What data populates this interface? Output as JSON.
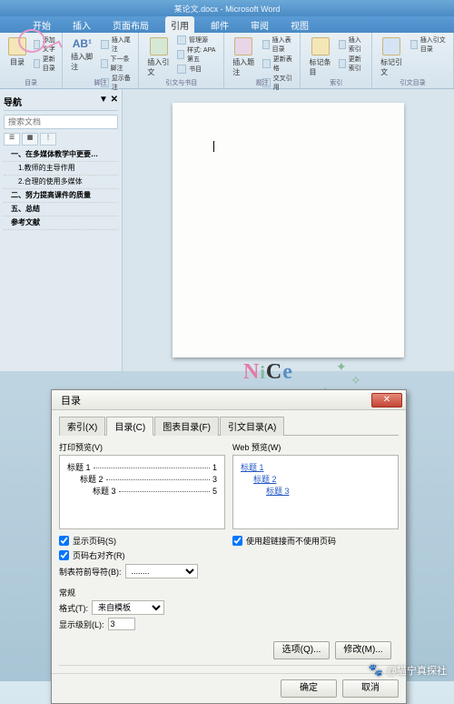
{
  "titlebar": "某论文.docx - Microsoft Word",
  "ribbon_tabs": [
    "开始",
    "插入",
    "页面布局",
    "引用",
    "邮件",
    "审阅",
    "视图"
  ],
  "ribbon_active_tab": "引用",
  "ribbon": {
    "g1": {
      "big": "目录",
      "rows": [
        "添加文字",
        "更新目录"
      ],
      "label": "目录"
    },
    "g2": {
      "big": "插入脚注",
      "ab": "AB¹",
      "rows": [
        "插入尾注",
        "下一条脚注",
        "显示备注"
      ],
      "label": "脚注"
    },
    "g3": {
      "big": "插入引文",
      "rows": [
        "管理源",
        "样式: APA 第五",
        "书目"
      ],
      "label": "引文与书目"
    },
    "g4": {
      "big": "插入题注",
      "rows": [
        "插入表目录",
        "更新表格",
        "交叉引用"
      ],
      "label": "题注"
    },
    "g5": {
      "big": "标记条目",
      "rows": [
        "插入索引",
        "更新索引"
      ],
      "label": "索引"
    },
    "g6": {
      "big": "标记引文",
      "rows": [
        "插入引文目录"
      ],
      "label": "引文目录"
    }
  },
  "nav": {
    "title": "导航",
    "search_ph": "搜索文档",
    "items": [
      {
        "text": "一、在多媒体教学中更要…",
        "cls": "bold"
      },
      {
        "text": "1.教师的主导作用",
        "cls": "sub"
      },
      {
        "text": "2.合理的使用多媒体",
        "cls": "sub"
      },
      {
        "text": "二、努力提高课件的质量",
        "cls": "bold"
      },
      {
        "text": "五、总结",
        "cls": "bold"
      },
      {
        "text": "参考文献",
        "cls": "bold"
      }
    ]
  },
  "dialog": {
    "title": "目录",
    "tabs": [
      "索引(X)",
      "目录(C)",
      "图表目录(F)",
      "引文目录(A)"
    ],
    "preview_print_label": "打印预览(V)",
    "preview_web_label": "Web 预览(W)",
    "toc": [
      {
        "t": "标题 1",
        "p": "1",
        "indent": 0
      },
      {
        "t": "标题 2",
        "p": "3",
        "indent": 1
      },
      {
        "t": "标题 3",
        "p": "5",
        "indent": 2
      }
    ],
    "web": [
      "标题 1",
      "标题 2",
      "标题 3"
    ],
    "chk_show_page": "显示页码(S)",
    "chk_right_align": "页码右对齐(R)",
    "chk_hyperlink": "使用超链接而不使用页码",
    "leader_label": "制表符前导符(B):",
    "leader_value": "........",
    "general_label": "常规",
    "format_label": "格式(T):",
    "format_value": "来自模板",
    "levels_label": "显示级别(L):",
    "levels_value": "3",
    "btn_options": "选项(Q)...",
    "btn_modify": "修改(M)...",
    "btn_ok": "确定",
    "btn_cancel": "取消"
  },
  "sticker": {
    "n": "N",
    "i": "i",
    "c": "C",
    "e": "e"
  },
  "watermark": "@猫宁真探社"
}
